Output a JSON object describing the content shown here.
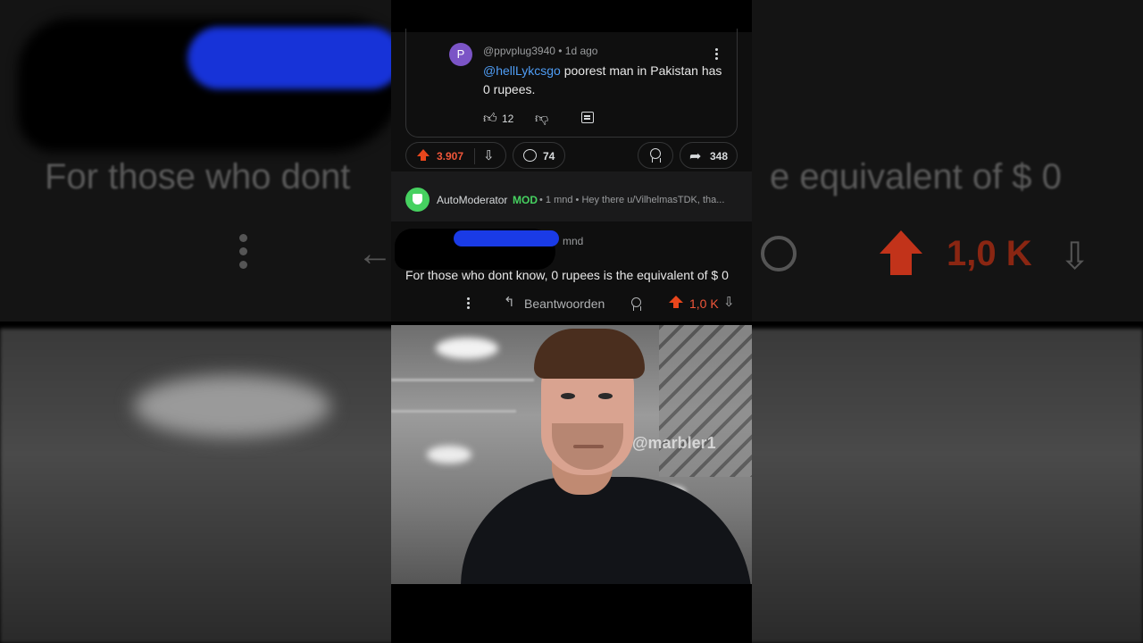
{
  "reply": {
    "avatar_letter": "P",
    "meta": "@ppvplug3940 • 1d ago",
    "mention": "@hellLykcsgo",
    "text": " poorest man in Pakistan has 0 rupees.",
    "likes": "12"
  },
  "post_actions": {
    "score": "3.907",
    "comments": "74",
    "shares": "348"
  },
  "automod": {
    "name": "AutoModerator",
    "mod_tag": "MOD",
    "meta": "• 1 mnd • Hey there u/VilhelmasTDK, tha..."
  },
  "comment": {
    "time": "mnd",
    "body": "For those who dont know,  0 rupees is the equivalent of  $ 0",
    "reply_label": "Beantwoorden",
    "score": "1,0 K"
  },
  "background": {
    "left_text": "For those who dont",
    "right_text": "e equivalent of  $ 0",
    "score": "1,0 K"
  },
  "photo": {
    "watermark": "@marbler1"
  },
  "icons": [
    "like-icon",
    "dislike-icon",
    "comment-icon",
    "upvote-icon",
    "downvote-icon",
    "chat-bubble-icon",
    "award-icon",
    "share-icon",
    "shield-icon",
    "reply-arrow-icon",
    "kebab-menu-icon"
  ],
  "colors": {
    "upvote": "#e8461c",
    "mention": "#4f9df5",
    "mod": "#46d160",
    "avatar": "#7b54c6"
  }
}
